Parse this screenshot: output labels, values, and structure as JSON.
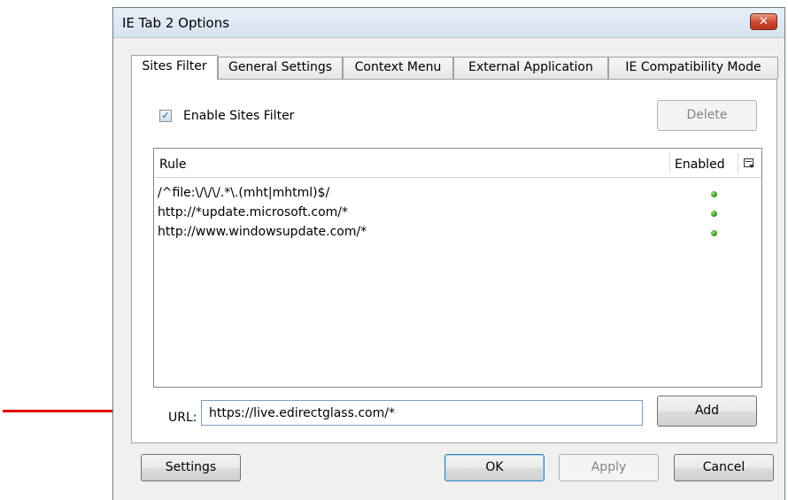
{
  "window": {
    "title": "IE Tab 2 Options",
    "close_glyph": "✕"
  },
  "tabs": [
    {
      "label": "Sites Filter",
      "active": true
    },
    {
      "label": "General Settings",
      "active": false
    },
    {
      "label": "Context Menu",
      "active": false
    },
    {
      "label": "External Application",
      "active": false
    },
    {
      "label": "IE Compatibility Mode",
      "active": false
    }
  ],
  "sites_filter": {
    "enable_label": "Enable Sites Filter",
    "enable_checked": true,
    "check_glyph": "✓",
    "delete_label": "Delete",
    "columns": {
      "rule": "Rule",
      "enabled": "Enabled"
    },
    "column_picker_icon": "column-picker-icon",
    "rules": [
      {
        "rule": "/^file:\\/\\/\\/.*\\.(mht|mhtml)$/",
        "enabled": true
      },
      {
        "rule": "http://*update.microsoft.com/*",
        "enabled": true
      },
      {
        "rule": "http://www.windowsupdate.com/*",
        "enabled": true
      }
    ],
    "enabled_indicator_color": "#3c9a1d",
    "url_label": "URL:",
    "url_value": "https://live.edirectglass.com/*",
    "add_label": "Add"
  },
  "footer": {
    "settings_label": "Settings",
    "ok_label": "OK",
    "apply_label": "Apply",
    "cancel_label": "Cancel"
  },
  "annotation": {
    "arrow_color": "#e00000",
    "arrow_icon": "right-arrow-icon"
  }
}
